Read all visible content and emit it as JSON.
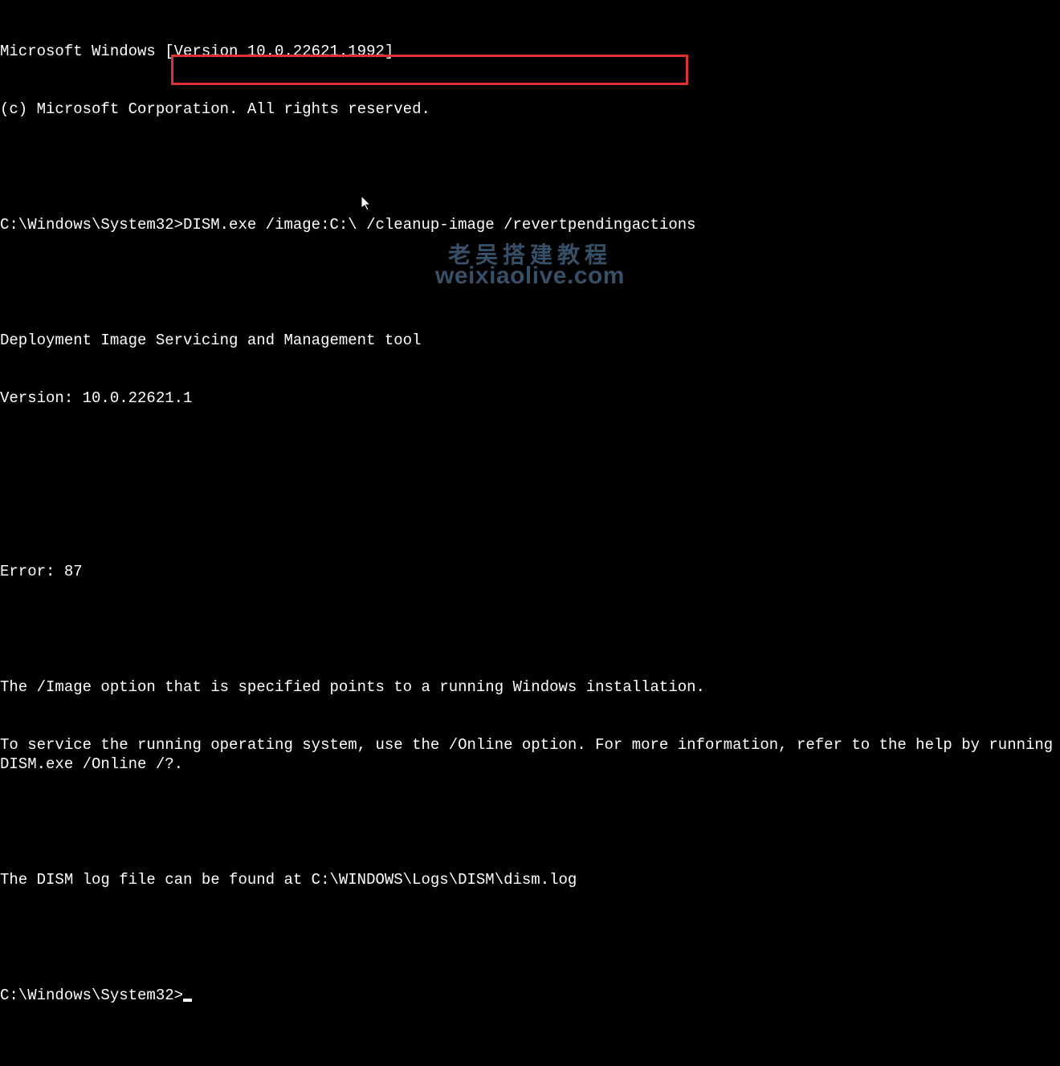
{
  "terminal": {
    "banner_line1": "Microsoft Windows [Version 10.0.22621.1992]",
    "banner_line2": "(c) Microsoft Corporation. All rights reserved.",
    "prompt1": "C:\\Windows\\System32>",
    "command": "DISM.exe /image:C:\\ /cleanup-image /revertpendingactions",
    "tool_title": "Deployment Image Servicing and Management tool",
    "tool_version": "Version: 10.0.22621.1",
    "error_line": "Error: 87",
    "error_msg1": "The /Image option that is specified points to a running Windows installation.",
    "error_msg2": "To service the running operating system, use the /Online option. For more information, refer to the help by running DISM.exe /Online /?.",
    "log_line": "The DISM log file can be found at C:\\WINDOWS\\Logs\\DISM\\dism.log",
    "prompt2": "C:\\Windows\\System32>"
  },
  "watermark": {
    "cn": "老吴搭建教程",
    "url": "weixiaolive.com"
  }
}
